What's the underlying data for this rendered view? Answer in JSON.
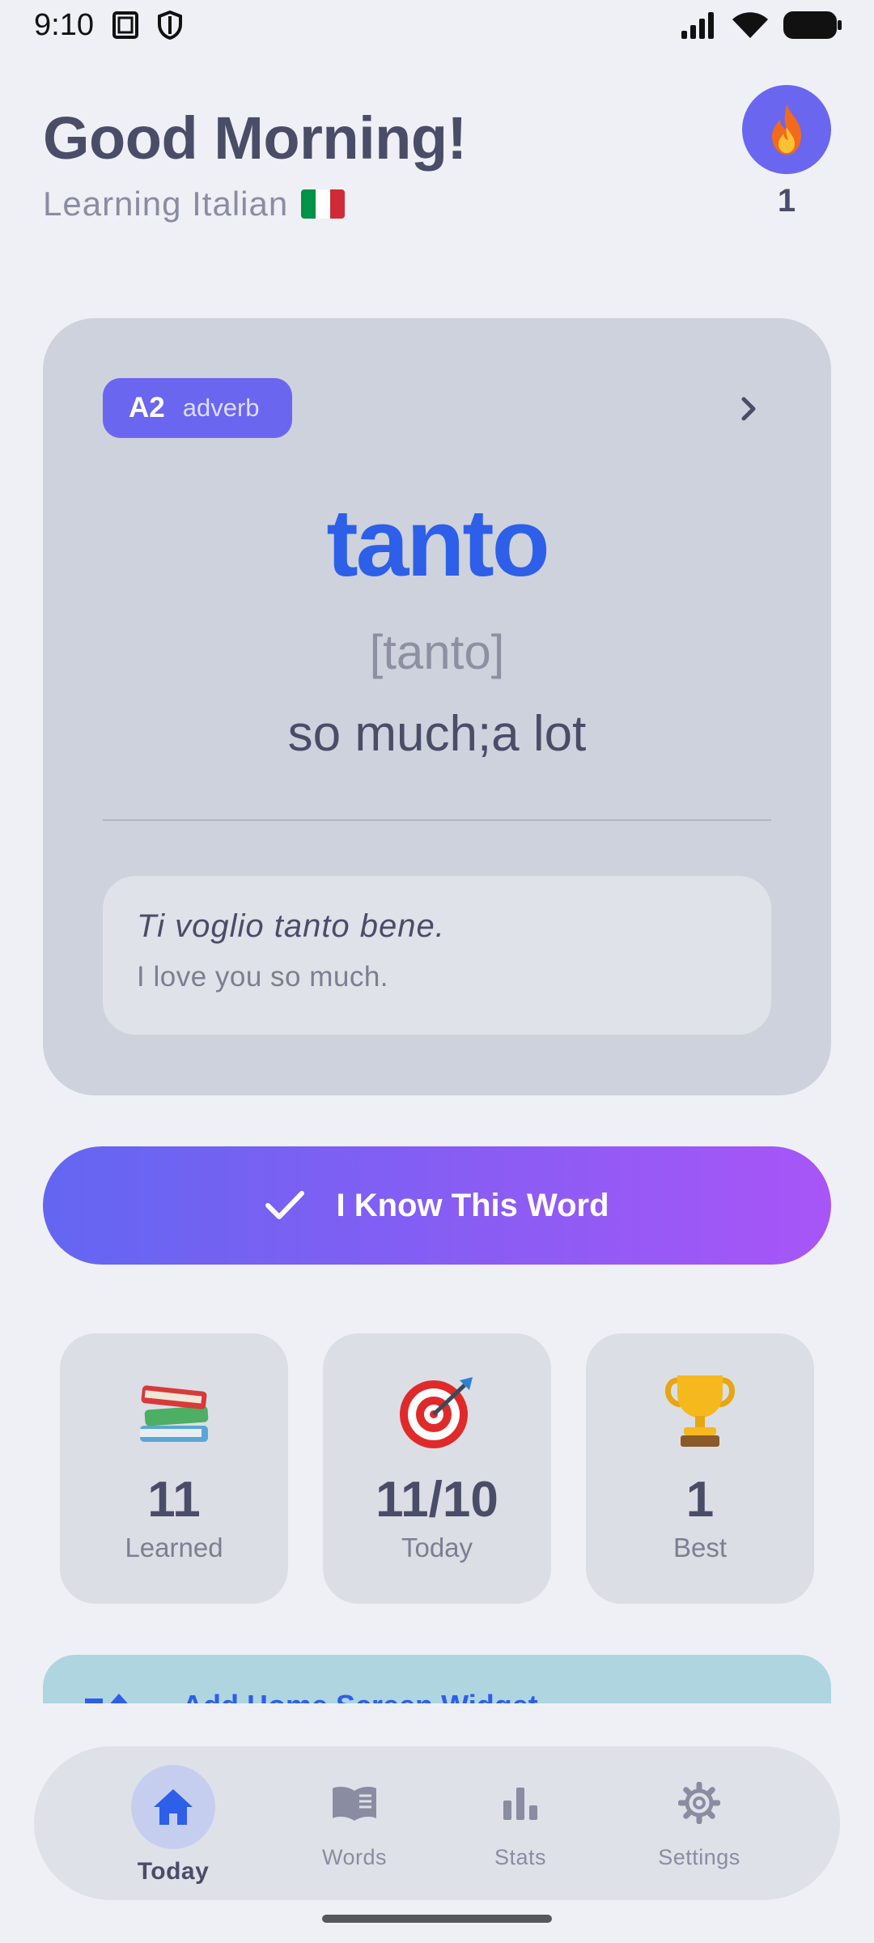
{
  "status_bar": {
    "time": "9:10"
  },
  "header": {
    "greeting": "Good Morning!",
    "subtitle": "Learning Italian",
    "flag_colors": [
      "#009246",
      "#ffffff",
      "#ce2b37"
    ],
    "streak": "1"
  },
  "card": {
    "level": "A2",
    "part_of_speech": "adverb",
    "word": "tanto",
    "pronunciation": "[tanto]",
    "translation": "so much;a lot",
    "example": "Ti voglio tanto bene.",
    "example_translation": "I love you so much."
  },
  "actions": {
    "know_label": "I Know This Word"
  },
  "stats": [
    {
      "icon": "books-icon",
      "value": "11",
      "label": "Learned"
    },
    {
      "icon": "target-icon",
      "value": "11/10",
      "label": "Today"
    },
    {
      "icon": "trophy-icon",
      "value": "1",
      "label": "Best"
    }
  ],
  "widget_banner": {
    "label": "Add Home Screen Widget"
  },
  "nav": {
    "items": [
      {
        "label": "Today",
        "icon": "home-icon",
        "active": true
      },
      {
        "label": "Words",
        "icon": "book-icon",
        "active": false
      },
      {
        "label": "Stats",
        "icon": "bar-chart-icon",
        "active": false
      },
      {
        "label": "Settings",
        "icon": "gear-icon",
        "active": false
      }
    ]
  },
  "colors": {
    "accent": "#6b66f0",
    "word": "#2d5fe8",
    "gradient_start": "#6366f1",
    "gradient_end": "#a855f7"
  }
}
